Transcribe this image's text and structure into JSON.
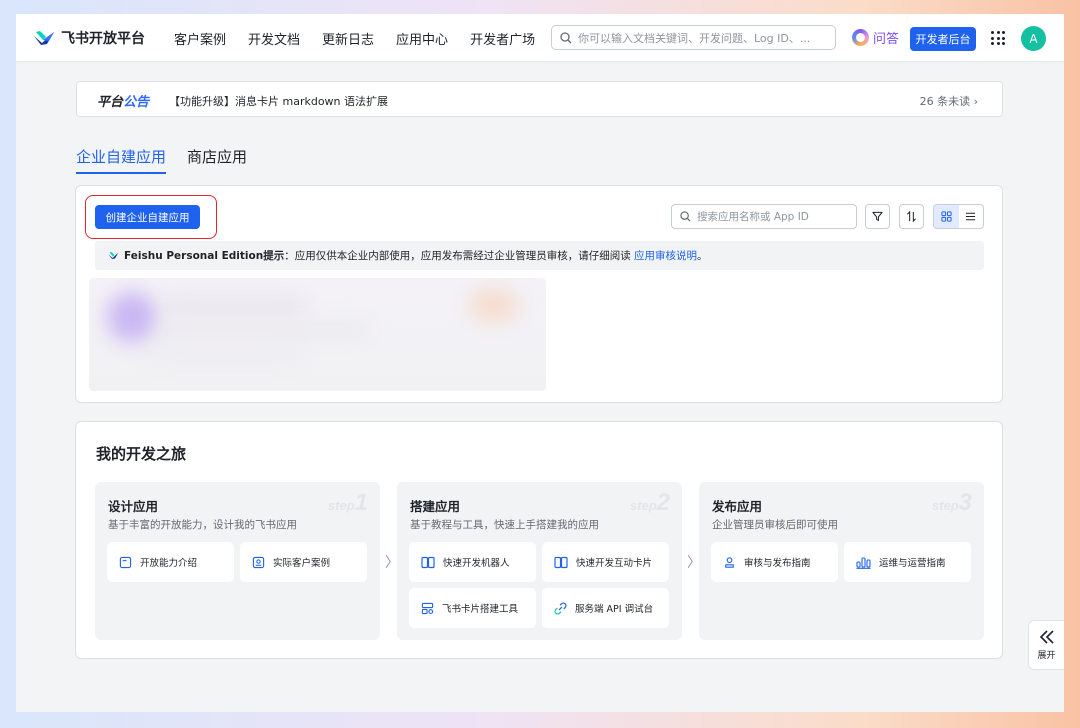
{
  "header": {
    "brand": "飞书开放平台",
    "nav": [
      "客户案例",
      "开发文档",
      "更新日志",
      "应用中心",
      "开发者广场"
    ],
    "search_placeholder": "你可以输入文档关键词、开发问题、Log ID、...",
    "qa_label": "问答",
    "dev_console_label": "开发者后台",
    "avatar_letter": "A"
  },
  "announcement": {
    "tag_part1": "平台",
    "tag_part2": "公告",
    "text": "【功能升级】消息卡片 markdown 语法扩展",
    "unread": "26 条未读"
  },
  "tabs": [
    {
      "label": "企业自建应用",
      "active": true
    },
    {
      "label": "商店应用",
      "active": false
    }
  ],
  "apps": {
    "create_button": "创建企业自建应用",
    "search_placeholder": "搜索应用名称或 App ID",
    "tip_brand": "Feishu Personal Edition提示",
    "tip_text": "：应用仅供本企业内部使用，应用发布需经过企业管理员审核，请仔细阅读 ",
    "tip_link": "应用审核说明",
    "tip_end": "。"
  },
  "journey": {
    "title": "我的开发之旅",
    "stages": [
      {
        "title": "设计应用",
        "desc": "基于丰富的开放能力，设计我的飞书应用",
        "step_word": "step",
        "step_num": "1",
        "entries": [
          {
            "label": "开放能力介绍",
            "icon": "capability-icon"
          },
          {
            "label": "实际客户案例",
            "icon": "case-icon"
          }
        ]
      },
      {
        "title": "搭建应用",
        "desc": "基于教程与工具，快速上手搭建我的应用",
        "step_word": "step",
        "step_num": "2",
        "entries": [
          {
            "label": "快速开发机器人",
            "icon": "book-icon"
          },
          {
            "label": "快速开发互动卡片",
            "icon": "book-icon"
          },
          {
            "label": "飞书卡片搭建工具",
            "icon": "card-builder-icon"
          },
          {
            "label": "服务端 API 调试台",
            "icon": "api-debug-icon"
          }
        ]
      },
      {
        "title": "发布应用",
        "desc": "企业管理员审核后即可使用",
        "step_word": "step",
        "step_num": "3",
        "entries": [
          {
            "label": "审核与发布指南",
            "icon": "review-icon"
          },
          {
            "label": "运维与运营指南",
            "icon": "stats-icon"
          }
        ]
      }
    ]
  },
  "sidebar_toggle": {
    "label": "展开"
  },
  "colors": {
    "accent": "#1e62ef",
    "highlight_border": "#e0242b",
    "qa": "#7b4ff0",
    "avatar": "#14c0a1"
  }
}
